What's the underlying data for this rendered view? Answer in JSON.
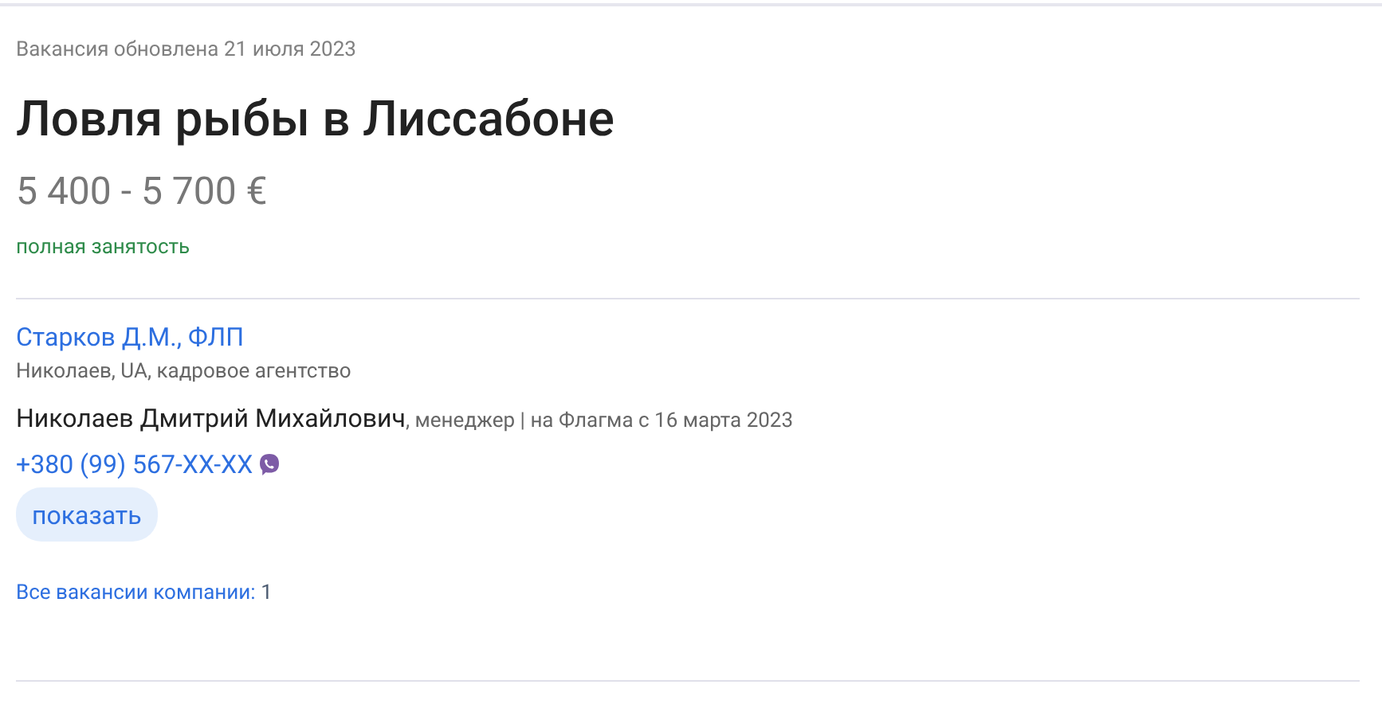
{
  "updated": "Вакансия обновлена 21 июля 2023",
  "title": "Ловля рыбы в Лиссабоне",
  "salary": "5 400 - 5 700 €",
  "employment": "полная занятость",
  "company": {
    "name": "Старков Д.М., ФЛП",
    "details": "Николаев, UA, кадровое агентство"
  },
  "contact": {
    "name": "Николаев Дмитрий Михайлович",
    "role": ", менеджер | на Флагма с 16 марта 2023",
    "phone": "+380 (99) 567-XX-XX",
    "show_button": "показать"
  },
  "all_vacancies": {
    "label": "Все вакансии компании:",
    "count": "1"
  }
}
